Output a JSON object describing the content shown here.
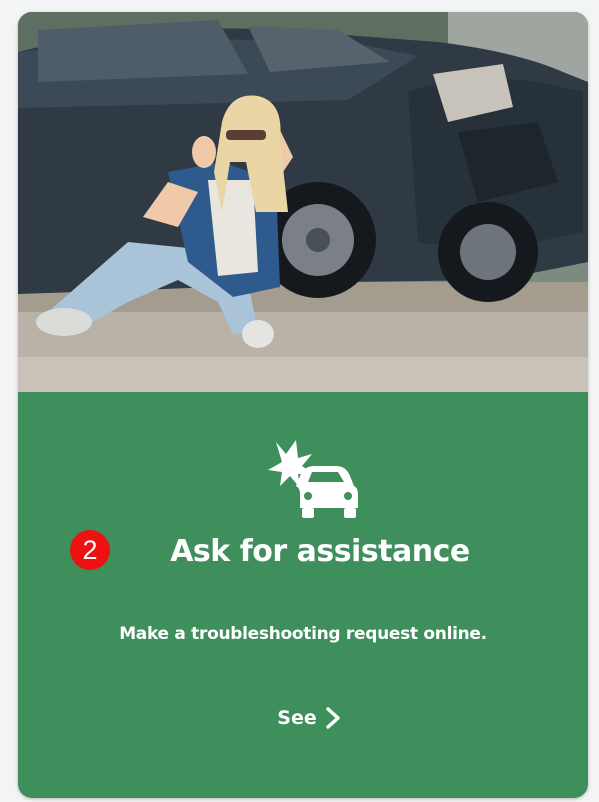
{
  "card": {
    "image_alt": "woman-sitting-beside-crashed-car",
    "icon": "car-crash-icon",
    "step_number": "2",
    "title": "Ask for assistance",
    "description": "Make a troubleshooting request online.",
    "link_label": "See",
    "link_icon": "chevron-right-icon"
  },
  "colors": {
    "card_green": "#3e8f5c",
    "badge_red": "#ee1111",
    "text": "#ffffff"
  }
}
